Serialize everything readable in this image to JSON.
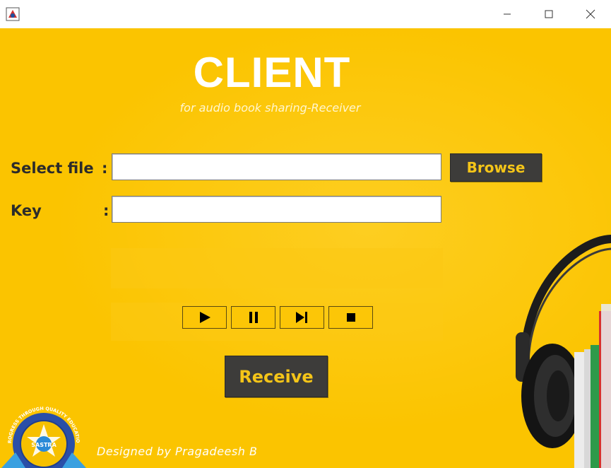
{
  "window": {
    "minimize_icon": "minimize-icon",
    "maximize_icon": "maximize-icon",
    "close_icon": "close-icon"
  },
  "header": {
    "title": "CLIENT",
    "subtitle": "for audio book sharing-Receiver"
  },
  "form": {
    "file_label": "Select file",
    "file_colon": ":",
    "file_value": "",
    "browse_label": "Browse",
    "key_label": "Key",
    "key_colon": ":",
    "key_value": ""
  },
  "player": {
    "controls": [
      "play-icon",
      "pause-icon",
      "skip-next-icon",
      "stop-icon"
    ]
  },
  "receive_label": "Receive",
  "footer": {
    "credit": "Designed by Pragadeesh B"
  },
  "logo": {
    "text_arc": "PROGRESS THROUGH QUALITY EDUCATION",
    "center_text": "SASTRA"
  },
  "colors": {
    "background": "#fbc400",
    "button_bg": "#3d3c3a",
    "button_text": "#f5c518"
  }
}
